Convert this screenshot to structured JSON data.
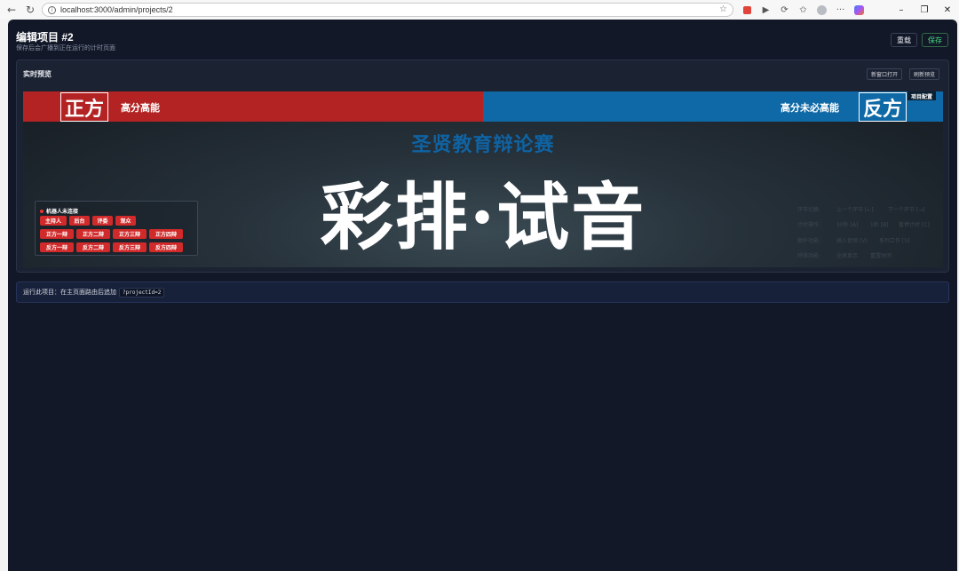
{
  "browser": {
    "url": "localhost:3000/admin/projects/2",
    "ellipsis": "···"
  },
  "header": {
    "title": "编辑项目 #2",
    "subtitle": "保存后会广播到正在运行的计时页面",
    "reload_label": "重载",
    "save_label": "保存"
  },
  "preview": {
    "title": "实时预览",
    "open_new_window_label": "新窗口打开",
    "refresh_label": "刷新预览"
  },
  "stage": {
    "pro_label": "正方",
    "con_label": "反方",
    "pro_slogan": "高分高能",
    "con_slogan": "高分未必高能",
    "project_config_label": "项目配置",
    "event_title": "圣贤教育辩论赛",
    "main_title": "彩排·试音",
    "colors": {
      "pro": "#b32323",
      "con": "#0f69a6",
      "robot_button": "#d12a2a"
    }
  },
  "robot": {
    "status": "机器人未连接",
    "row1": [
      "主持人",
      "后台",
      "评委",
      "观众"
    ],
    "row2": [
      "正方一辩",
      "正方二辩",
      "正方三辩",
      "正方四辩"
    ],
    "row3": [
      "反方一辩",
      "反方二辩",
      "反方三辩",
      "反方四辩"
    ]
  },
  "ghost_hotkeys": [
    {
      "label": "环节切换:",
      "a": "上一个环节 [←]",
      "b": "下一个环节 [→]"
    },
    {
      "label": "计时操作:",
      "a": "30秒 [A]",
      "b": "1秒 [B]",
      "c": "暂停计时 [C]"
    },
    {
      "label": "额外功能:",
      "a": "插入音频 [V]",
      "b": "系列工作 [S]"
    },
    {
      "label": "特殊功能:",
      "a": "全屏显示",
      "b": "重置时间"
    }
  ],
  "info_bar": {
    "text": "运行此项目：在主页面路由后追加",
    "code": "?projectId=2"
  }
}
